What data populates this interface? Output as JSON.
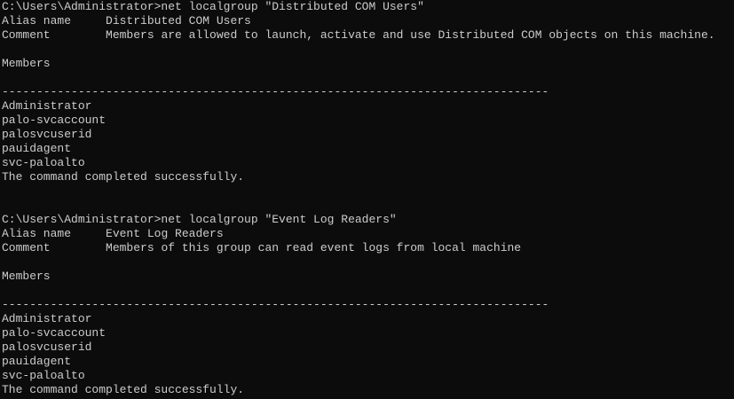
{
  "blocks": [
    {
      "command": "C:\\Users\\Administrator>net localgroup \"Distributed COM Users\"",
      "alias_label": "Alias name     ",
      "alias_value": "Distributed COM Users",
      "comment_label": "Comment        ",
      "comment_value": "Members are allowed to launch, activate and use Distributed COM objects on this machine.",
      "members_heading": "Members",
      "separator": "-------------------------------------------------------------------------------",
      "members": [
        "Administrator",
        "palo-svcaccount",
        "palosvcuserid",
        "pauidagent",
        "svc-paloalto"
      ],
      "status": "The command completed successfully."
    },
    {
      "command": "C:\\Users\\Administrator>net localgroup \"Event Log Readers\"",
      "alias_label": "Alias name     ",
      "alias_value": "Event Log Readers",
      "comment_label": "Comment        ",
      "comment_value": "Members of this group can read event logs from local machine",
      "members_heading": "Members",
      "separator": "-------------------------------------------------------------------------------",
      "members": [
        "Administrator",
        "palo-svcaccount",
        "palosvcuserid",
        "pauidagent",
        "svc-paloalto"
      ],
      "status": "The command completed successfully."
    }
  ]
}
